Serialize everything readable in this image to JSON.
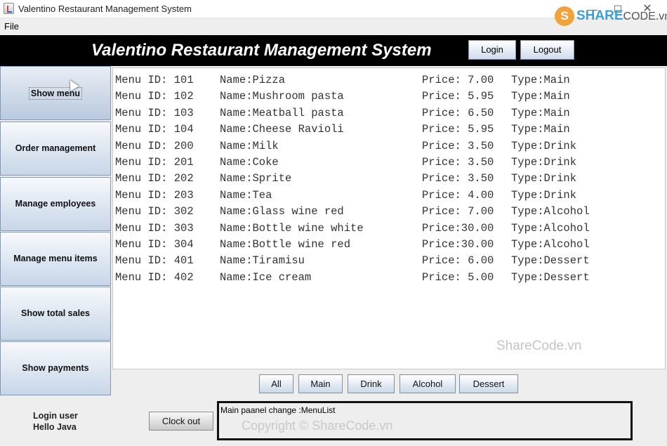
{
  "window": {
    "title": "Valentino Restaurant Management System",
    "min_glyph": "—",
    "max_glyph": "☐",
    "close_glyph": "✕"
  },
  "watermark": {
    "logo_letter": "S",
    "logo_text_bold": "SHARE",
    "logo_text_light": "CODE.vn",
    "middle_text": "ShareCode.vn",
    "copyright_text": "Copyright © ShareCode.vn"
  },
  "menubar": {
    "file_label": "File"
  },
  "header": {
    "title": "Valentino Restaurant Management System",
    "login_label": "Login",
    "logout_label": "Logout"
  },
  "sidebar": {
    "items": [
      {
        "label": "Show menu"
      },
      {
        "label": "Order management"
      },
      {
        "label": "Manage employees"
      },
      {
        "label": "Manage menu items"
      },
      {
        "label": "Show total sales"
      },
      {
        "label": "Show payments"
      }
    ]
  },
  "menu_list": [
    {
      "id": "Menu ID: 101",
      "name": "Name:Pizza",
      "price": "Price: 7.00",
      "type": "Type:Main"
    },
    {
      "id": "Menu ID: 102",
      "name": "Name:Mushroom pasta",
      "price": "Price: 5.95",
      "type": "Type:Main"
    },
    {
      "id": "Menu ID: 103",
      "name": "Name:Meatball pasta",
      "price": "Price: 6.50",
      "type": "Type:Main"
    },
    {
      "id": "Menu ID: 104",
      "name": "Name:Cheese Ravioli",
      "price": "Price: 5.95",
      "type": "Type:Main"
    },
    {
      "id": "Menu ID: 200",
      "name": "Name:Milk",
      "price": "Price: 3.50",
      "type": "Type:Drink"
    },
    {
      "id": "Menu ID: 201",
      "name": "Name:Coke",
      "price": "Price: 3.50",
      "type": "Type:Drink"
    },
    {
      "id": "Menu ID: 202",
      "name": "Name:Sprite",
      "price": "Price: 3.50",
      "type": "Type:Drink"
    },
    {
      "id": "Menu ID: 203",
      "name": "Name:Tea",
      "price": "Price: 4.00",
      "type": "Type:Drink"
    },
    {
      "id": "Menu ID: 302",
      "name": "Name:Glass wine red",
      "price": "Price: 7.00",
      "type": "Type:Alcohol"
    },
    {
      "id": "Menu ID: 303",
      "name": "Name:Bottle wine white",
      "price": "Price:30.00",
      "type": "Type:Alcohol"
    },
    {
      "id": "Menu ID: 304",
      "name": "Name:Bottle wine red",
      "price": "Price:30.00",
      "type": "Type:Alcohol"
    },
    {
      "id": "Menu ID: 401",
      "name": "Name:Tiramisu",
      "price": "Price: 6.00",
      "type": "Type:Dessert"
    },
    {
      "id": "Menu ID: 402",
      "name": "Name:Ice cream",
      "price": "Price: 5.00",
      "type": "Type:Dessert"
    }
  ],
  "filters": {
    "all": "All",
    "main": "Main",
    "drink": "Drink",
    "alcohol": "Alcohol",
    "dessert": "Dessert"
  },
  "footer": {
    "login_user_line1": "Login user",
    "login_user_line2": "Hello Java",
    "clock_out_label": "Clock out",
    "status_text": "Main paanel change :MenuList"
  }
}
